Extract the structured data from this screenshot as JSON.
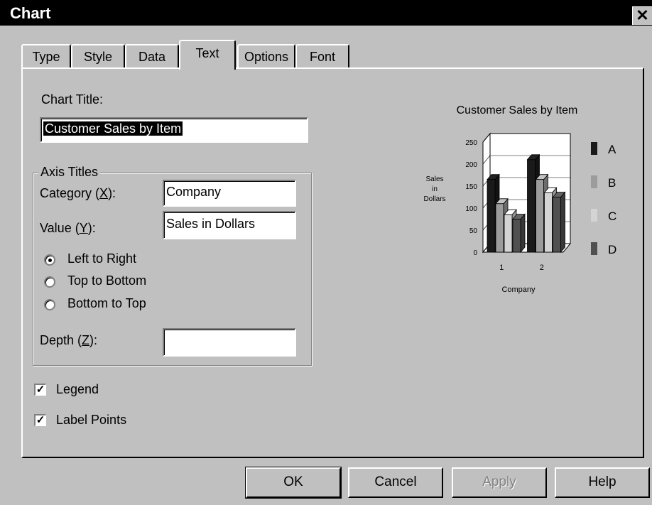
{
  "window": {
    "title": "Chart",
    "close_glyph": "✕"
  },
  "tabs": [
    {
      "label": "Type"
    },
    {
      "label": "Style"
    },
    {
      "label": "Data"
    },
    {
      "label": "Text",
      "active": true
    },
    {
      "label": "Options"
    },
    {
      "label": "Font"
    }
  ],
  "form": {
    "chart_title_label": "Chart Title:",
    "chart_title_value": "Customer Sales by Item",
    "axis_titles_label": "Axis Titles",
    "category_label_pre": "Category (",
    "category_label_key": "X",
    "category_label_post": "):",
    "category_value": "Company",
    "value_label_pre": "Value (",
    "value_label_key": "Y",
    "value_label_post": "):",
    "value_value": "Sales in Dollars",
    "orientation": [
      {
        "label": "Left to Right",
        "selected": true
      },
      {
        "label": "Top to Bottom",
        "selected": false
      },
      {
        "label": "Bottom to Top",
        "selected": false
      }
    ],
    "depth_label_pre": "Depth (",
    "depth_label_key": "Z",
    "depth_label_post": "):",
    "depth_value": "",
    "legend_label": "Legend",
    "legend_checked": true,
    "label_points_label": "Label Points",
    "label_points_checked": true
  },
  "buttons": {
    "ok": "OK",
    "cancel": "Cancel",
    "apply": "Apply",
    "help": "Help"
  },
  "chart_data": {
    "type": "bar",
    "title": "Customer Sales by Item",
    "xlabel": "Company",
    "ylabel": "Sales in Dollars",
    "ylabel_lines": [
      "Sales",
      "in",
      "Dollars"
    ],
    "ylim": [
      0,
      250
    ],
    "yticks": [
      0,
      50,
      100,
      150,
      200,
      250
    ],
    "categories": [
      "1",
      "2"
    ],
    "series": [
      {
        "name": "A",
        "values": [
          165,
          210
        ],
        "color": "#1a1a1a"
      },
      {
        "name": "B",
        "values": [
          110,
          165
        ],
        "color": "#9c9c9c"
      },
      {
        "name": "C",
        "values": [
          85,
          135
        ],
        "color": "#d4d4d4"
      },
      {
        "name": "D",
        "values": [
          75,
          125
        ],
        "color": "#505050"
      }
    ],
    "legend_position": "right",
    "grid": true,
    "style": "3d"
  }
}
